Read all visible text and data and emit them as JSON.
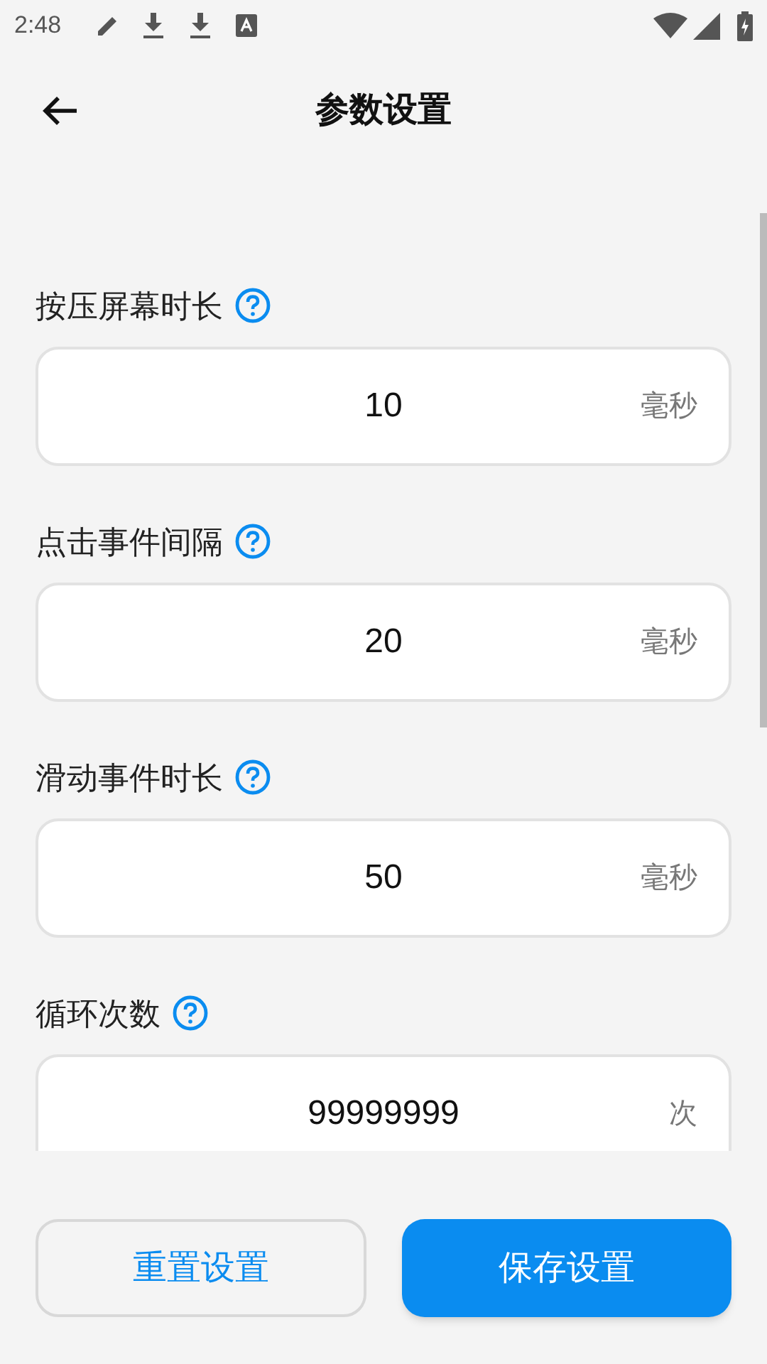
{
  "status_bar": {
    "time": "2:48"
  },
  "header": {
    "title": "参数设置"
  },
  "fields": [
    {
      "label": "按压屏幕时长",
      "value": "10",
      "unit": "毫秒"
    },
    {
      "label": "点击事件间隔",
      "value": "20",
      "unit": "毫秒"
    },
    {
      "label": "滑动事件时长",
      "value": "50",
      "unit": "毫秒"
    },
    {
      "label": "循环次数",
      "value": "99999999",
      "unit": "次"
    }
  ],
  "buttons": [
    {
      "label": "重置设置",
      "kind": "outline"
    },
    {
      "label": "保存设置",
      "kind": "primary"
    }
  ]
}
